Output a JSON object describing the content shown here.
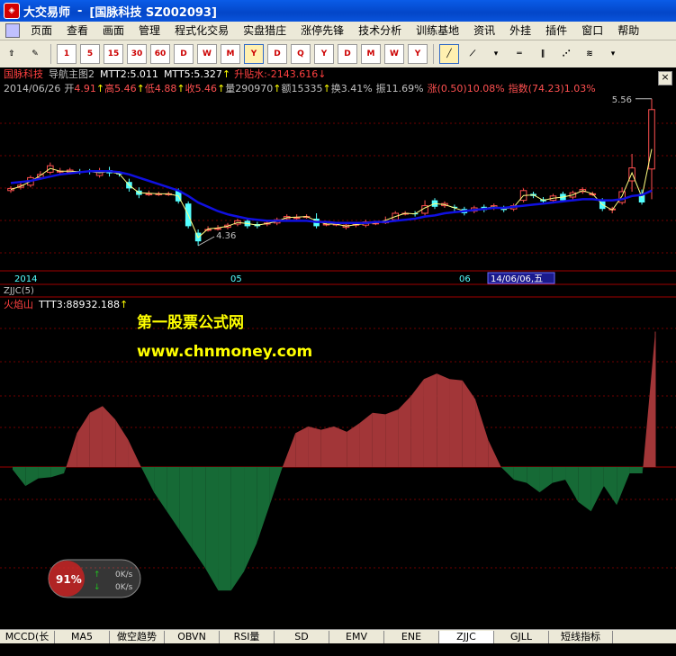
{
  "window": {
    "app_name": "大交易师",
    "separator": "-",
    "doc_title": "[国脉科技  SZ002093]"
  },
  "menu": [
    "页面",
    "查看",
    "画面",
    "管理",
    "程式化交易",
    "实盘猎庄",
    "涨停先锋",
    "技术分析",
    "训练基地",
    "资讯",
    "外挂",
    "插件",
    "窗口",
    "帮助"
  ],
  "toolbar_glyphs": [
    "1",
    "5",
    "15",
    "30",
    "60",
    "D",
    "W",
    "M",
    "Y",
    "D",
    "Q",
    "Y",
    "D",
    "M",
    "W",
    "Y"
  ],
  "price_panel": {
    "name": "国脉科技",
    "formula": "导航主图2",
    "mtt2": "MTT2:5.011",
    "mtt5": "MTT5:5.327",
    "mtt5_arrow": "↑",
    "shengtie": "升贴水:-2143.616",
    "shengtie_arrow": "↓",
    "date": "2014/06/26",
    "open_label": "开",
    "open": "4.91",
    "open_arrow": "↑",
    "high_label": "高",
    "high": "5.46",
    "high_arrow": "↑",
    "low_label": "低",
    "low": "4.88",
    "low_arrow": "↑",
    "close_label": "收",
    "close": "5.46",
    "close_arrow": "↑",
    "vol_label": "量",
    "vol": "290970",
    "vol_arrow": "↑",
    "amt_label": "额",
    "amt": "15335",
    "amt_arrow": "↑",
    "turn_label": "换",
    "turn": "3.41%",
    "amp_label": "振",
    "amp": "11.69%",
    "chg_label": "涨",
    "chg": "(0.50)10.08%",
    "idx_label": "指数",
    "idx": "(74.23)1.03%",
    "high_marker": "5.56",
    "low_marker": "4.36"
  },
  "time_axis": {
    "year": "2014",
    "m1": "05",
    "m2": "06",
    "cursor": "14/06/06,五"
  },
  "indicator_panel": {
    "name": "ZJJC(5)",
    "subname": "火焰山",
    "ttt3": "TTT3:88932.188",
    "ttt3_arrow": "↑",
    "watermark1": "第一股票公式网",
    "watermark2": "www.chnmoney.com"
  },
  "speed_widget": {
    "percent": "91%",
    "up": "0K/s",
    "down": "0K/s"
  },
  "tabs": [
    "MCCD(长波)",
    "MA5",
    "做空趋势",
    "OBVN",
    "RSI量",
    "SD",
    "EMV",
    "ENE",
    "ZJJC",
    "GJLL",
    "短线指标"
  ],
  "colors": {
    "up": "#ff5050",
    "down": "#54ffff",
    "ma_blue": "#1010e0",
    "area_red": "#a23638",
    "area_green": "#166a36"
  },
  "chart_data": {
    "type": "area",
    "candles": [
      {
        "o": 4.71,
        "c": 4.73,
        "h": 4.75,
        "l": 4.69
      },
      {
        "o": 4.74,
        "c": 4.76,
        "h": 4.78,
        "l": 4.72
      },
      {
        "o": 4.76,
        "c": 4.83,
        "h": 4.85,
        "l": 4.74
      },
      {
        "o": 4.83,
        "c": 4.86,
        "h": 4.89,
        "l": 4.81
      },
      {
        "o": 4.88,
        "c": 4.94,
        "h": 4.97,
        "l": 4.86
      },
      {
        "o": 4.89,
        "c": 4.89,
        "h": 4.92,
        "l": 4.86
      },
      {
        "o": 4.88,
        "c": 4.9,
        "h": 4.92,
        "l": 4.86
      },
      {
        "o": 4.89,
        "c": 4.88,
        "h": 4.91,
        "l": 4.86
      },
      {
        "o": 4.89,
        "c": 4.88,
        "h": 4.91,
        "l": 4.86
      },
      {
        "o": 4.85,
        "c": 4.89,
        "h": 4.92,
        "l": 4.83
      },
      {
        "o": 4.9,
        "c": 4.87,
        "h": 4.93,
        "l": 4.84
      },
      {
        "o": 4.87,
        "c": 4.86,
        "h": 4.89,
        "l": 4.84
      },
      {
        "o": 4.79,
        "c": 4.73,
        "h": 4.82,
        "l": 4.7
      },
      {
        "o": 4.71,
        "c": 4.67,
        "h": 4.74,
        "l": 4.64
      },
      {
        "o": 4.68,
        "c": 4.68,
        "h": 4.71,
        "l": 4.66
      },
      {
        "o": 4.68,
        "c": 4.68,
        "h": 4.7,
        "l": 4.66
      },
      {
        "o": 4.68,
        "c": 4.68,
        "h": 4.7,
        "l": 4.66
      },
      {
        "o": 4.71,
        "c": 4.61,
        "h": 4.73,
        "l": 4.59
      },
      {
        "o": 4.59,
        "c": 4.38,
        "h": 4.61,
        "l": 4.36
      },
      {
        "o": 4.32,
        "c": 4.24,
        "h": 4.35,
        "l": 4.2
      },
      {
        "o": 4.35,
        "c": 4.35,
        "h": 4.38,
        "l": 4.33
      },
      {
        "o": 4.36,
        "c": 4.36,
        "h": 4.39,
        "l": 4.34
      },
      {
        "o": 4.37,
        "c": 4.39,
        "h": 4.41,
        "l": 4.35
      },
      {
        "o": 4.4,
        "c": 4.43,
        "h": 4.45,
        "l": 4.38
      },
      {
        "o": 4.43,
        "c": 4.38,
        "h": 4.45,
        "l": 4.36
      },
      {
        "o": 4.4,
        "c": 4.38,
        "h": 4.42,
        "l": 4.36
      },
      {
        "o": 4.4,
        "c": 4.41,
        "h": 4.43,
        "l": 4.38
      },
      {
        "o": 4.41,
        "c": 4.44,
        "h": 4.46,
        "l": 4.39
      },
      {
        "o": 4.45,
        "c": 4.47,
        "h": 4.49,
        "l": 4.43
      },
      {
        "o": 4.46,
        "c": 4.46,
        "h": 4.49,
        "l": 4.44
      },
      {
        "o": 4.47,
        "c": 4.47,
        "h": 4.49,
        "l": 4.45
      },
      {
        "o": 4.45,
        "c": 4.38,
        "h": 4.5,
        "l": 4.36
      },
      {
        "o": 4.4,
        "c": 4.4,
        "h": 4.42,
        "l": 4.38
      },
      {
        "o": 4.4,
        "c": 4.4,
        "h": 4.42,
        "l": 4.38
      },
      {
        "o": 4.37,
        "c": 4.39,
        "h": 4.41,
        "l": 4.35
      },
      {
        "o": 4.39,
        "c": 4.4,
        "h": 4.42,
        "l": 4.37
      },
      {
        "o": 4.39,
        "c": 4.42,
        "h": 4.44,
        "l": 4.37
      },
      {
        "o": 4.41,
        "c": 4.41,
        "h": 4.43,
        "l": 4.39
      },
      {
        "o": 4.42,
        "c": 4.42,
        "h": 4.47,
        "l": 4.4
      },
      {
        "o": 4.44,
        "c": 4.5,
        "h": 4.52,
        "l": 4.42
      },
      {
        "o": 4.5,
        "c": 4.5,
        "h": 4.52,
        "l": 4.48
      },
      {
        "o": 4.5,
        "c": 4.49,
        "h": 4.52,
        "l": 4.47
      },
      {
        "o": 4.5,
        "c": 4.57,
        "h": 4.62,
        "l": 4.48
      },
      {
        "o": 4.62,
        "c": 4.56,
        "h": 4.64,
        "l": 4.54
      },
      {
        "o": 4.57,
        "c": 4.59,
        "h": 4.61,
        "l": 4.55
      },
      {
        "o": 4.56,
        "c": 4.55,
        "h": 4.58,
        "l": 4.52
      },
      {
        "o": 4.54,
        "c": 4.5,
        "h": 4.56,
        "l": 4.48
      },
      {
        "o": 4.52,
        "c": 4.55,
        "h": 4.57,
        "l": 4.5
      },
      {
        "o": 4.56,
        "c": 4.53,
        "h": 4.58,
        "l": 4.51
      },
      {
        "o": 4.55,
        "c": 4.57,
        "h": 4.59,
        "l": 4.53
      },
      {
        "o": 4.55,
        "c": 4.53,
        "h": 4.57,
        "l": 4.51
      },
      {
        "o": 4.54,
        "c": 4.57,
        "h": 4.59,
        "l": 4.52
      },
      {
        "o": 4.62,
        "c": 4.71,
        "h": 4.73,
        "l": 4.6
      },
      {
        "o": 4.68,
        "c": 4.66,
        "h": 4.7,
        "l": 4.64
      },
      {
        "o": 4.63,
        "c": 4.61,
        "h": 4.65,
        "l": 4.59
      },
      {
        "o": 4.62,
        "c": 4.66,
        "h": 4.68,
        "l": 4.6
      },
      {
        "o": 4.68,
        "c": 4.62,
        "h": 4.7,
        "l": 4.6
      },
      {
        "o": 4.65,
        "c": 4.69,
        "h": 4.71,
        "l": 4.63
      },
      {
        "o": 4.7,
        "c": 4.72,
        "h": 4.74,
        "l": 4.68
      },
      {
        "o": 4.68,
        "c": 4.68,
        "h": 4.7,
        "l": 4.66
      },
      {
        "o": 4.62,
        "c": 4.54,
        "h": 4.64,
        "l": 4.52
      },
      {
        "o": 4.54,
        "c": 4.54,
        "h": 4.56,
        "l": 4.5
      },
      {
        "o": 4.6,
        "c": 4.7,
        "h": 4.74,
        "l": 4.58
      },
      {
        "o": 4.8,
        "c": 4.92,
        "h": 5.05,
        "l": 4.7
      },
      {
        "o": 4.68,
        "c": 4.6,
        "h": 4.72,
        "l": 4.58
      },
      {
        "o": 4.91,
        "c": 5.46,
        "h": 5.56,
        "l": 4.63
      }
    ],
    "ma": [
      4.78,
      4.79,
      4.8,
      4.82,
      4.84,
      4.86,
      4.87,
      4.88,
      4.89,
      4.89,
      4.89,
      4.88,
      4.86,
      4.83,
      4.8,
      4.77,
      4.74,
      4.71,
      4.66,
      4.6,
      4.56,
      4.52,
      4.49,
      4.47,
      4.45,
      4.44,
      4.43,
      4.43,
      4.43,
      4.43,
      4.43,
      4.42,
      4.42,
      4.41,
      4.41,
      4.41,
      4.41,
      4.42,
      4.42,
      4.43,
      4.44,
      4.45,
      4.47,
      4.48,
      4.5,
      4.51,
      4.52,
      4.53,
      4.54,
      4.55,
      4.55,
      4.56,
      4.57,
      4.58,
      4.59,
      4.6,
      4.61,
      4.62,
      4.63,
      4.63,
      4.62,
      4.62,
      4.63,
      4.66,
      4.67,
      4.71
    ],
    "indicator_values": [
      -4000,
      -30000,
      -18000,
      -16000,
      -10000,
      50000,
      80000,
      90000,
      70000,
      40000,
      0,
      -40000,
      -70000,
      -100000,
      -130000,
      -160000,
      -195000,
      -195000,
      -165000,
      -120000,
      -60000,
      0,
      50000,
      60000,
      55000,
      60000,
      52000,
      65000,
      80000,
      78000,
      85000,
      105000,
      130000,
      138000,
      130000,
      128000,
      100000,
      40000,
      0,
      -20000,
      -25000,
      -40000,
      -25000,
      -20000,
      -55000,
      -70000,
      -30000,
      -60000,
      -10000,
      -10000,
      200000
    ],
    "price_ylim": [
      4.0,
      5.7
    ],
    "indicator_ylim": [
      -250000,
      210000
    ]
  }
}
